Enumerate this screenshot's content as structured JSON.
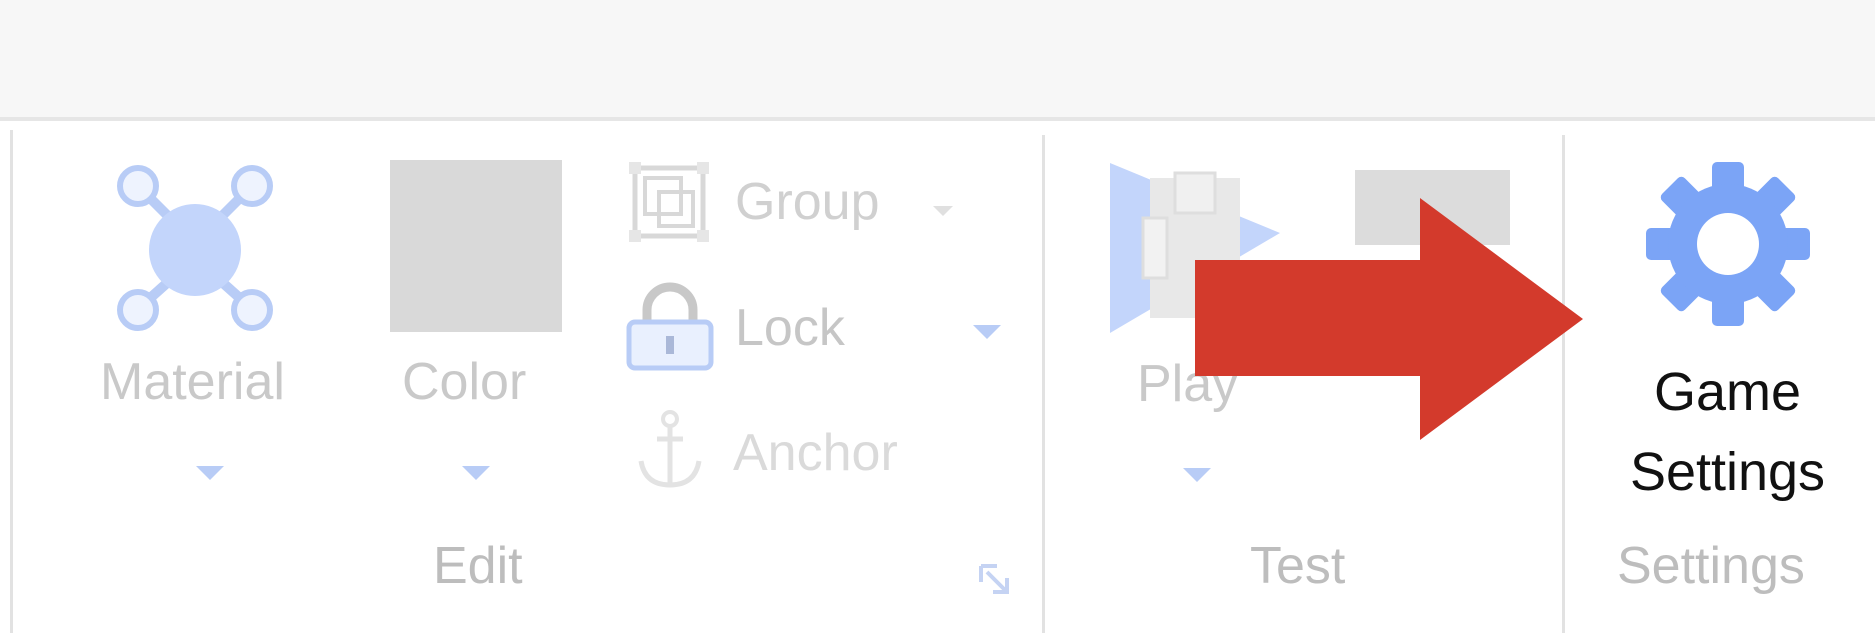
{
  "ribbon": {
    "edit_group": {
      "label": "Edit",
      "material": {
        "label": "Material",
        "icon": "material-icon"
      },
      "color": {
        "label": "Color",
        "swatch_color": "#d9d9d9"
      },
      "group": {
        "label": "Group",
        "icon": "group-icon"
      },
      "lock": {
        "label": "Lock",
        "icon": "lock-icon"
      },
      "anchor": {
        "label": "Anchor",
        "icon": "anchor-icon"
      },
      "expand_icon": "dialog-launcher-icon"
    },
    "test_group": {
      "label": "Test",
      "play": {
        "label": "Play",
        "icon": "play-icon"
      },
      "stop": {
        "label": "",
        "icon": "stop-icon"
      }
    },
    "settings_group": {
      "label": "Settings",
      "game_settings": {
        "line1": "Game",
        "line2": "Settings",
        "icon": "gear-icon",
        "icon_color": "#7ba4f6"
      }
    }
  },
  "annotation": {
    "arrow_color": "#d33a2c",
    "icon": "red-arrow-icon"
  }
}
